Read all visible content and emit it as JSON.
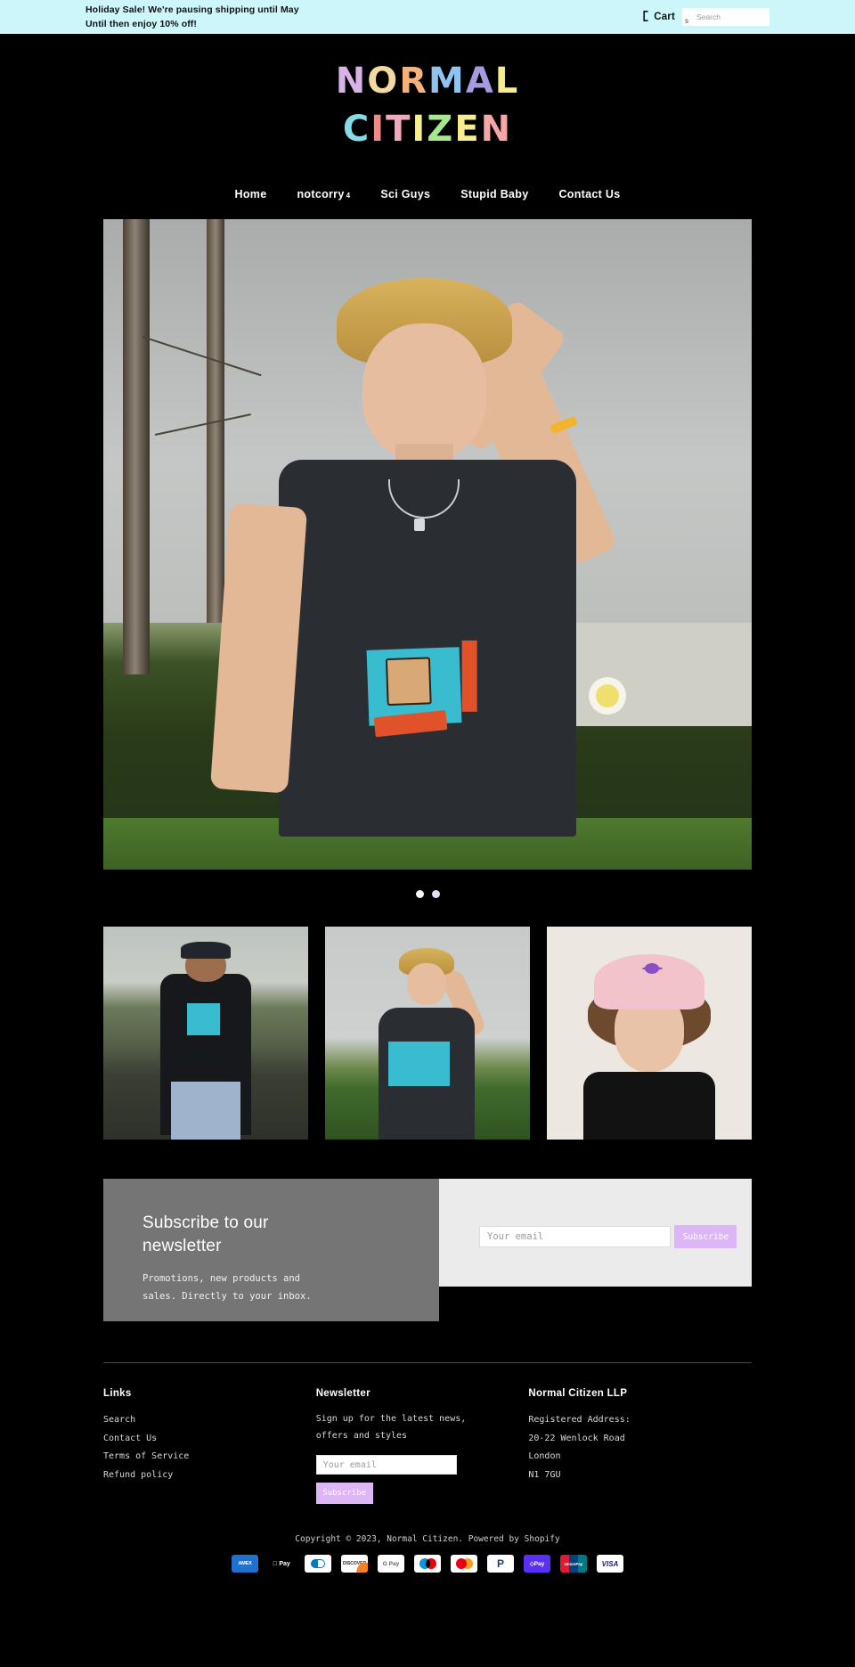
{
  "announcement": {
    "line1": "Holiday Sale! We're pausing shipping until May",
    "line2": "Until then enjoy 10% off!",
    "bg_color": "#cdf6fb"
  },
  "topbar": {
    "cart_label": "Cart",
    "cart_icon": "cart-icon",
    "search_placeholder": "Search",
    "search_value": "",
    "search_icon": "search-icon"
  },
  "logo": {
    "line1": "NORMAL",
    "line2": "CITIZEN",
    "letters_line1": [
      {
        "ch": "N",
        "color": "#d9b3e8"
      },
      {
        "ch": "O",
        "color": "#f2d9a0"
      },
      {
        "ch": "R",
        "color": "#f7b278"
      },
      {
        "ch": "M",
        "color": "#8fc4f0"
      },
      {
        "ch": "A",
        "color": "#a79ae0"
      },
      {
        "ch": "L",
        "color": "#f6ee8e"
      }
    ],
    "letters_line2": [
      {
        "ch": "C",
        "color": "#86dbe8"
      },
      {
        "ch": "I",
        "color": "#ef8a8a"
      },
      {
        "ch": "T",
        "color": "#f3a9bd"
      },
      {
        "ch": "I",
        "color": "#f6ee8e"
      },
      {
        "ch": "Z",
        "color": "#a6e88a"
      },
      {
        "ch": "E",
        "color": "#f6ee8e"
      },
      {
        "ch": "N",
        "color": "#f7a6a6"
      }
    ]
  },
  "nav": {
    "items": [
      {
        "label": "Home",
        "sup": "",
        "active": true
      },
      {
        "label": "notcorry",
        "sup": "4",
        "active": false
      },
      {
        "label": "Sci Guys",
        "sup": "",
        "active": false
      },
      {
        "label": "Stupid Baby",
        "sup": "",
        "active": false
      },
      {
        "label": "Contact Us",
        "sup": "",
        "active": false
      }
    ]
  },
  "hero": {
    "alt": "Model wearing black Stupid Baby t-shirt outdoors",
    "dots": [
      {
        "label": "slide-1",
        "active": true
      },
      {
        "label": "slide-2",
        "active": false
      }
    ]
  },
  "products": [
    {
      "alt": "Model in black jacket on railway tracks wearing Stupid Baby tee"
    },
    {
      "alt": "Model outdoors wearing Stupid Baby tee"
    },
    {
      "alt": "Model wearing pink planet embroidered cap"
    }
  ],
  "newsletter_band": {
    "title": "Subscribe to our newsletter",
    "subtitle": "Promotions, new products and sales. Directly to your inbox.",
    "email_placeholder": "Your email",
    "email_value": "",
    "button_label": "Subscribe",
    "button_color": "#dcb6f5",
    "left_bg": "#757575",
    "right_bg": "#ebebeb"
  },
  "footer": {
    "links": {
      "title": "Links",
      "items": [
        "Search",
        "Contact Us",
        "Terms of Service",
        "Refund policy"
      ]
    },
    "newsletter": {
      "title": "Newsletter",
      "description": "Sign up for the latest news, offers and styles",
      "email_placeholder": "Your email",
      "email_value": "",
      "button_label": "Subscribe"
    },
    "company": {
      "title": "Normal Citizen LLP",
      "lines": [
        "Registered Address:",
        "20-22 Wenlock Road",
        "London",
        "N1 7GU"
      ]
    },
    "copyright": "Copyright © 2023, Normal Citizen. Powered by Shopify",
    "payments": [
      {
        "name": "american-express",
        "label": "AMEX"
      },
      {
        "name": "apple-pay",
        "label": "Pay"
      },
      {
        "name": "diners-club",
        "label": ""
      },
      {
        "name": "discover",
        "label": "DISCOVER"
      },
      {
        "name": "google-pay",
        "label": "G Pay"
      },
      {
        "name": "maestro",
        "label": ""
      },
      {
        "name": "mastercard",
        "label": ""
      },
      {
        "name": "paypal",
        "label": "P"
      },
      {
        "name": "shop-pay",
        "label": "◇Pay"
      },
      {
        "name": "union-pay",
        "label": "UnionPay"
      },
      {
        "name": "visa",
        "label": "VISA"
      }
    ]
  }
}
